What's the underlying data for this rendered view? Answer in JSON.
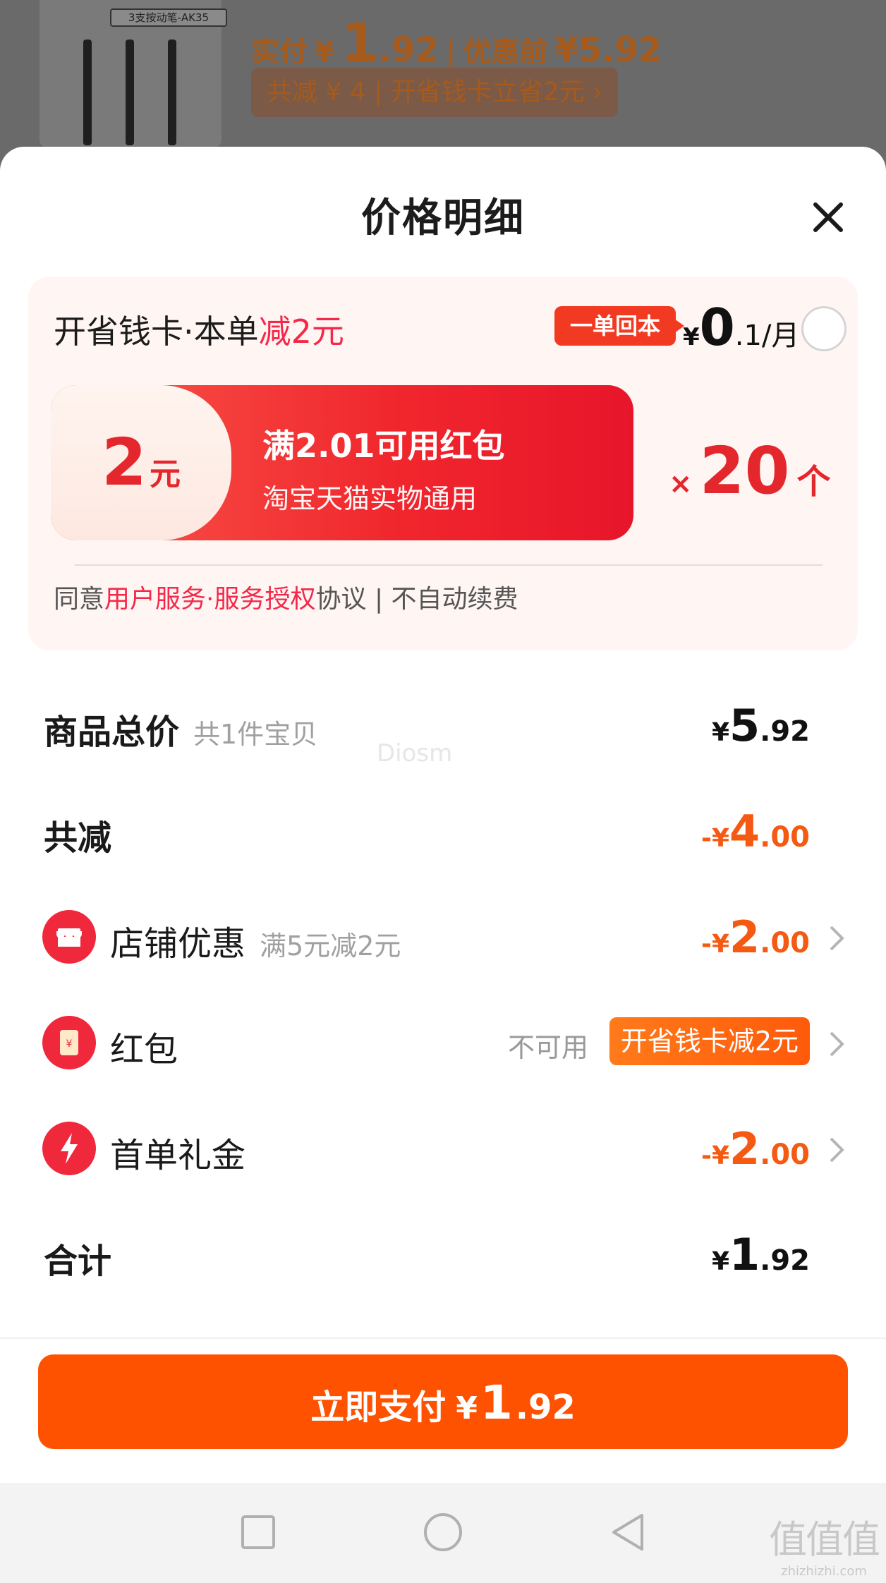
{
  "backdrop": {
    "product_tag": "3支按动笔-AK35",
    "paid_label": "实付",
    "paid_currency": "¥",
    "paid_int": "1",
    "paid_dec": ".92",
    "separator": "|",
    "before_label": "优惠前",
    "before_price": "¥5.92",
    "savings_line": "共减 ¥ 4 | 开省钱卡立省2元 ›"
  },
  "sheet": {
    "title": "价格明细"
  },
  "promo": {
    "head_prefix": "开省钱卡·本单",
    "head_highlight": "减2元",
    "badge": "一单回本",
    "price_currency": "¥",
    "price_int": "0",
    "price_rest": ".1/月",
    "coupon_amount": "2",
    "coupon_unit": "元",
    "coupon_title": "满2.01可用红包",
    "coupon_desc": "淘宝天猫实物通用",
    "times_symbol": "×",
    "count": "20",
    "count_unit": "个",
    "agree_prefix": "同意",
    "agree_link1": "用户服务",
    "agree_dot": "·",
    "agree_link2": "服务授权",
    "agree_suffix": "协议 | 不自动续费"
  },
  "rows": {
    "total": {
      "label": "商品总价",
      "sub": "共1件宝贝",
      "currency": "¥",
      "int": "5",
      "dec": ".92"
    },
    "discount": {
      "label": "共减",
      "currency": "-¥",
      "int": "4",
      "dec": ".00"
    },
    "shop": {
      "label": "店铺优惠",
      "sub": "满5元减2元",
      "currency": "-¥",
      "int": "2",
      "dec": ".00"
    },
    "redpacket": {
      "label": "红包",
      "unavailable": "不可用",
      "pill": "开省钱卡减2元"
    },
    "firstorder": {
      "label": "首单礼金",
      "currency": "-¥",
      "int": "2",
      "dec": ".00"
    },
    "sum": {
      "label": "合计",
      "currency": "¥",
      "int": "1",
      "dec": ".92"
    }
  },
  "watermark": "Diosm",
  "pay": {
    "label": "立即支付",
    "currency": "¥",
    "int": "1",
    "dec": ".92"
  },
  "site_mark": {
    "glyphs": "值值值",
    "url": "zhizhizhi.com"
  },
  "colors": {
    "accent_orange": "#ff5200",
    "accent_red": "#f5284a",
    "coupon_red": "#e8152a"
  }
}
